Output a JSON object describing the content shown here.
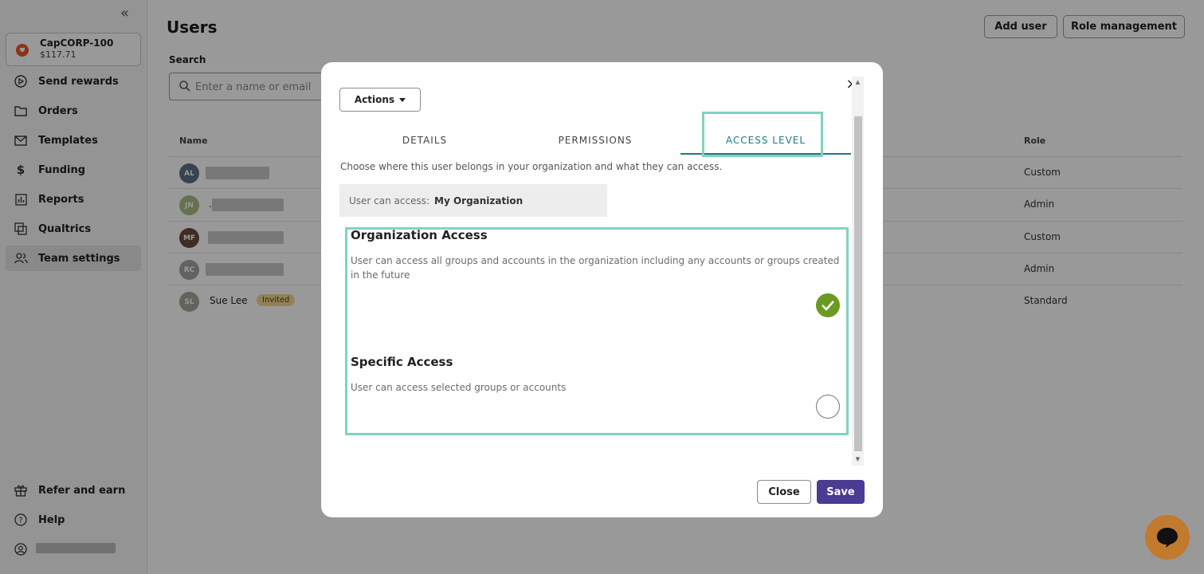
{
  "sidebar": {
    "collapse_icon": "double-chevron-left-icon",
    "account": {
      "name": "CapCORP-100",
      "balance": "$117.71"
    },
    "items": [
      {
        "label": "Send rewards",
        "icon": "send-icon"
      },
      {
        "label": "Orders",
        "icon": "folder-icon"
      },
      {
        "label": "Templates",
        "icon": "mail-icon"
      },
      {
        "label": "Funding",
        "icon": "dollar-icon"
      },
      {
        "label": "Reports",
        "icon": "bar-chart-icon"
      },
      {
        "label": "Qualtrics",
        "icon": "qualtrics-icon"
      },
      {
        "label": "Team settings",
        "icon": "team-icon",
        "active": true
      }
    ],
    "bottom_items": [
      {
        "label": "Refer and earn",
        "icon": "gift-icon"
      },
      {
        "label": "Help",
        "icon": "help-icon"
      }
    ]
  },
  "main": {
    "title": "Users",
    "add_user": "Add user",
    "role_management": "Role management",
    "search_label": "Search",
    "search_placeholder": "Enter a name or email",
    "columns": {
      "name": "Name",
      "role": "Role"
    },
    "rows": [
      {
        "initials": "AL",
        "name": "",
        "role": "Custom",
        "avatar_color": "#5c7084"
      },
      {
        "initials": "JN",
        "name": ".",
        "role": "Admin",
        "avatar_color": "#a8bd84"
      },
      {
        "initials": "MF",
        "name": "",
        "role": "Custom",
        "avatar_color": "#6b4a3c"
      },
      {
        "initials": "RC",
        "name": "",
        "role": "Admin",
        "avatar_color": "#a3a3a3"
      },
      {
        "initials": "SL",
        "name": "Sue Lee",
        "badge": "Invited",
        "role": "Standard",
        "avatar_color": "#a7a39a"
      }
    ]
  },
  "modal": {
    "actions_label": "Actions",
    "tabs": [
      "DETAILS",
      "PERMISSIONS",
      "ACCESS LEVEL"
    ],
    "active_tab": "ACCESS LEVEL",
    "description": "Choose where this user belongs in your organization and what they can access.",
    "access_label": "User can access:",
    "access_value": "My Organization",
    "options": [
      {
        "title": "Organization Access",
        "description": "User can access all groups and accounts in the organization including any accounts or groups created in the future",
        "selected": true
      },
      {
        "title": "Specific Access",
        "description": "User can access selected groups or accounts",
        "selected": false
      }
    ],
    "close_label": "Close",
    "save_label": "Save"
  },
  "colors": {
    "accent": "#1f7a7f",
    "highlight": "#7fd3c4",
    "save": "#4b3b92",
    "selected": "#6a9a22",
    "chat": "#c17a2e"
  }
}
